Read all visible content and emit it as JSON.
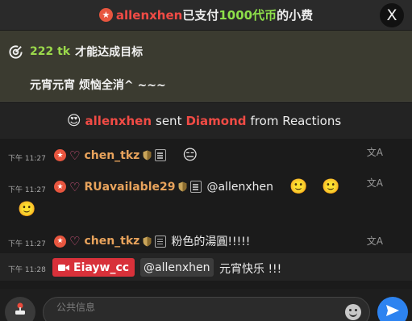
{
  "tip_banner": {
    "user": "allenxhen",
    "text_before_amount": "已支付",
    "amount": "1000代币",
    "text_after_amount": "的小费",
    "close_label": "X"
  },
  "goal": {
    "amount": "222 tk",
    "label": "才能达成目标",
    "description": "元宵元宵 烦恼全消^ ~~~"
  },
  "reaction": {
    "emoji": "😍",
    "user": "allenxhen",
    "sent_text": "sent",
    "gift": "Diamond",
    "source": "from Reactions"
  },
  "messages": [
    {
      "time": "下午 11:27",
      "user": "chen_tkz",
      "text": "",
      "emojis": [
        "😑"
      ]
    },
    {
      "time": "下午 11:27",
      "user": "RUavailable29",
      "text": "@allenxhen",
      "emojis": [
        "🙂",
        "🙂",
        "🙂"
      ]
    },
    {
      "time": "下午 11:27",
      "user": "chen_tkz",
      "text": "粉色的湯圓!!!!!",
      "emojis": []
    }
  ],
  "last_message": {
    "time": "下午 11:28",
    "user": "Eiayw_cc",
    "mention": "@allenxhen",
    "text": "元宵快乐 !!!"
  },
  "input": {
    "placeholder": "公共信息"
  },
  "icons": {
    "translate": "translate-icon",
    "shield": "shield-icon",
    "note": "note-icon",
    "send": "send-icon"
  },
  "colors": {
    "accent_red": "#f04b45",
    "tip_green": "#8ee04a",
    "username_orange": "#e8a35c",
    "send_blue": "#2d83f0"
  }
}
